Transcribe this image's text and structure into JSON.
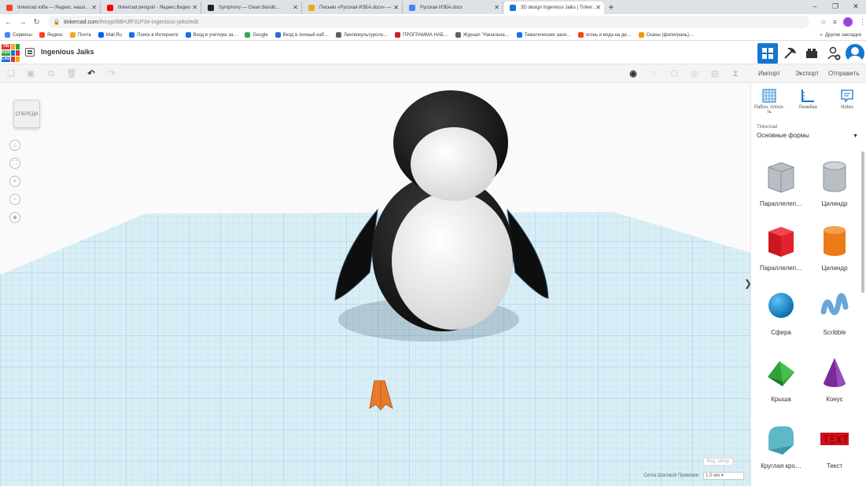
{
  "browser": {
    "tabs": [
      {
        "title": "tinkercad изба — Яндекс: нашл…",
        "favicon_color": "#fc3f1d",
        "active": false
      },
      {
        "title": "tinkercad penguin - Яндекс.Видео",
        "favicon_color": "#ff0000",
        "active": false
      },
      {
        "title": "Symphony — Clean Bandit…",
        "favicon_color": "#202124",
        "active": false
      },
      {
        "title": "Письмо «Русская ИЗБА.docx» — …",
        "favicon_color": "#f5a623",
        "active": false
      },
      {
        "title": "Русская ИЗБА.docx",
        "favicon_color": "#4285f4",
        "active": false
      },
      {
        "title": "3D design Ingenious Jaiks | Tinker…",
        "favicon_color": "#1477d1",
        "active": true
      }
    ],
    "url_host": "tinkercad.com",
    "url_path": "/things/8BHJlF31P3e-ingenious-jaiks/edit",
    "profile_initial": "O",
    "bookmarks": [
      {
        "label": "Сервисы",
        "color": "#4285f4"
      },
      {
        "label": "Яндекс",
        "color": "#fc3f1d"
      },
      {
        "label": "Почта",
        "color": "#f5a623"
      },
      {
        "label": "Mail.Ru",
        "color": "#005ff9"
      },
      {
        "label": "Поиск в Интернете",
        "color": "#1a73e8"
      },
      {
        "label": "Вход в учетную за…",
        "color": "#1a73e8"
      },
      {
        "label": "Google",
        "color": "#34a853"
      },
      {
        "label": "Вход в личный каб…",
        "color": "#3367d6"
      },
      {
        "label": "Лингвокультуроло…",
        "color": "#5f6368"
      },
      {
        "label": "ПРОГРАММА НАБ…",
        "color": "#c5221f"
      },
      {
        "label": "Журнал \"Начальна…",
        "color": "#5f6368"
      },
      {
        "label": "Тематические заня…",
        "color": "#1a73e8"
      },
      {
        "label": "огонь и вода на де…",
        "color": "#fc3f1d"
      },
      {
        "label": "Сканы (филигрань)…",
        "color": "#f29900"
      }
    ],
    "other_bookmarks": "Другие закладки"
  },
  "tinkercad": {
    "logo_letters": [
      "TIN",
      "KER",
      "CAD"
    ],
    "design_title": "Ingenious Jaiks",
    "toolbar": {
      "import_label": "Импорт",
      "export_label": "Экспорт",
      "send_label": "Отправить"
    },
    "viewcube_label": "СПЕРЕДИ",
    "edit_grid_label": "Ред. сетку",
    "snap_label": "Сетка Шаговой Привязки",
    "snap_value": "1,0 мм"
  },
  "panel": {
    "tools": [
      {
        "label": "Рабоч. плоск-ть"
      },
      {
        "label": "Линейка"
      },
      {
        "label": "Notes"
      }
    ],
    "library_label": "Tinkercad",
    "library_value": "Основные формы",
    "shapes": [
      {
        "name": "Параллелеп…",
        "color": "#b9bec4"
      },
      {
        "name": "Цилиндр",
        "color": "#b9bec4"
      },
      {
        "name": "Параллелеп…",
        "color": "#e3222b"
      },
      {
        "name": "Цилиндр",
        "color": "#ec7a16"
      },
      {
        "name": "Сфера",
        "color": "#1b8fd4"
      },
      {
        "name": "Scribble",
        "color": "#6aa6d8"
      },
      {
        "name": "Крыша",
        "color": "#2fa13a"
      },
      {
        "name": "Конус",
        "color": "#7b2a9b"
      },
      {
        "name": "Круглая кро…",
        "color": "#5fb8c8"
      },
      {
        "name": "Текст",
        "color": "#d0101a"
      }
    ]
  }
}
